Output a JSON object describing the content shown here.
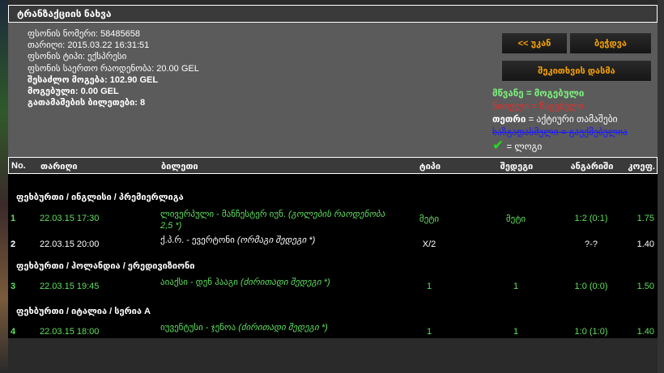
{
  "title": "ტრანზაქციის ნახვა",
  "info": [
    {
      "label": "ფსონის ნომერი:",
      "value": "58485658",
      "bold": false
    },
    {
      "label": "თარიღი:",
      "value": "2015.03.22 16:31:51",
      "bold": false
    },
    {
      "label": "ფსონის ტიპი:",
      "value": "ექსპრესი",
      "bold": false
    },
    {
      "label": "ფსონის საერთო რაოდენობა:",
      "value": "20.00 GEL",
      "bold": false
    },
    {
      "label": "შესაძლო მოგება:",
      "value": "102.90 GEL",
      "bold": true
    },
    {
      "label": "მოგებული:",
      "value": "0.00 GEL",
      "bold": true
    },
    {
      "label": "გათამაშების ბილეთები:",
      "value": "8",
      "bold": true
    }
  ],
  "buttons": {
    "back": "<< უკან",
    "print": "ბეჭდვა",
    "ask": "შეკითხვის დასმა"
  },
  "legend": {
    "green": "მწვანე = მოგებული",
    "red": "წითელი = წაგებული",
    "white_key": "თეთრი",
    "white_rest": " = აქტიური თამაშები",
    "cancelled": "ხაზგადასმული = გაუქმებულია",
    "check": "= ლოგი",
    "colors": {
      "green": "#7cf07c",
      "red": "#e03030",
      "blue": "#1a1aff",
      "accent": "#f5a000"
    }
  },
  "headers": {
    "no": "No.",
    "date": "თარიღი",
    "ticket": "ბილეთი",
    "type": "ტიპი",
    "result": "შედეგი",
    "score": "ანგარიში",
    "coef": "კოეფ."
  },
  "groups": [
    {
      "name": "ფეხბურთი / ინგლისი / პრემიერლიგა",
      "rows": [
        {
          "no": "1",
          "date": "22.03.15 17:30",
          "match": "ლივერპული - მანჩესტერ იუნ.",
          "market": "(გოლების რაოდენობა",
          "market2": "2,5 *)",
          "type": "მეტი",
          "result": "მეტი",
          "score": "1:2 (0:1)",
          "coef": "1.75",
          "color": "g"
        },
        {
          "no": "2",
          "date": "22.03.15 20:00",
          "match": "ქ.პ.რ. - ევერტონი",
          "market": "(ორმაგი შედეგი *)",
          "market2": "",
          "type": "X/2",
          "result": "",
          "score": "?-?",
          "coef": "1.40",
          "color": "w"
        }
      ]
    },
    {
      "name": "ფეხბურთი / ჰოლანდია / ერედივიზიონი",
      "rows": [
        {
          "no": "3",
          "date": "22.03.15 19:45",
          "match": "აიაქსი - დენ ჰააგი",
          "market": "(ძირითადი შედეგი *)",
          "market2": "",
          "type": "1",
          "result": "1",
          "score": "1:0 (0:0)",
          "coef": "1.50",
          "color": "g"
        }
      ]
    },
    {
      "name": "ფეხბურთი / იტალია / სერია A",
      "rows": [
        {
          "no": "4",
          "date": "22.03.15 18:00",
          "match": "იუვენტუსი - ჯენოა",
          "market": "(ძირითადი შედეგი *)",
          "market2": "",
          "type": "1",
          "result": "1",
          "score": "1:0 (1:0)",
          "coef": "1.40",
          "color": "g"
        }
      ]
    }
  ]
}
